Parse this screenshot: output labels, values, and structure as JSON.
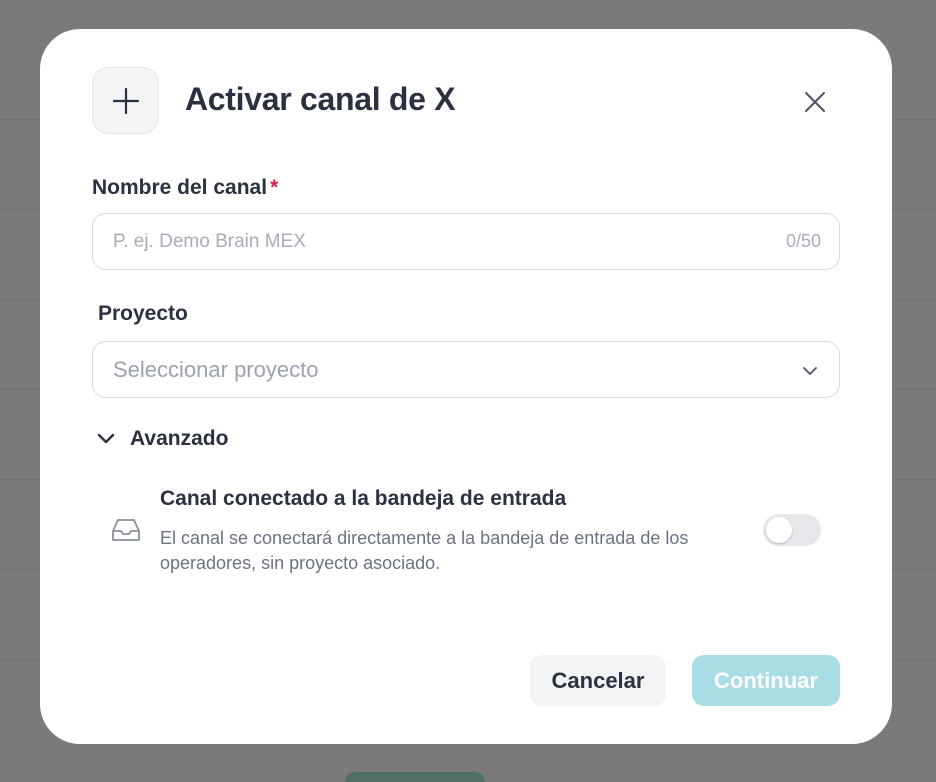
{
  "dialog": {
    "title": "Activar canal de X"
  },
  "channel_name": {
    "label": "Nombre del canal",
    "required_mark": "*",
    "placeholder": "P. ej. Demo Brain MEX",
    "value": "",
    "counter": "0/50"
  },
  "project": {
    "label": "Proyecto",
    "placeholder": "Seleccionar proyecto"
  },
  "advanced": {
    "label": "Avanzado",
    "option": {
      "title": "Canal conectado a la bandeja de entrada",
      "description": "El canal se conectará directamente a la bandeja de entrada de los operadores, sin proyecto asociado.",
      "enabled": false
    }
  },
  "actions": {
    "cancel_label": "Cancelar",
    "continue_label": "Continuar"
  },
  "colors": {
    "accent_disabled": "#a9dde6",
    "required": "#e11d48",
    "text_primary": "#2b3140"
  },
  "icons": {
    "header": "plus-icon",
    "close": "close-icon",
    "select": "chevron-down-icon",
    "advanced": "chevron-down-icon",
    "option": "inbox-icon"
  }
}
